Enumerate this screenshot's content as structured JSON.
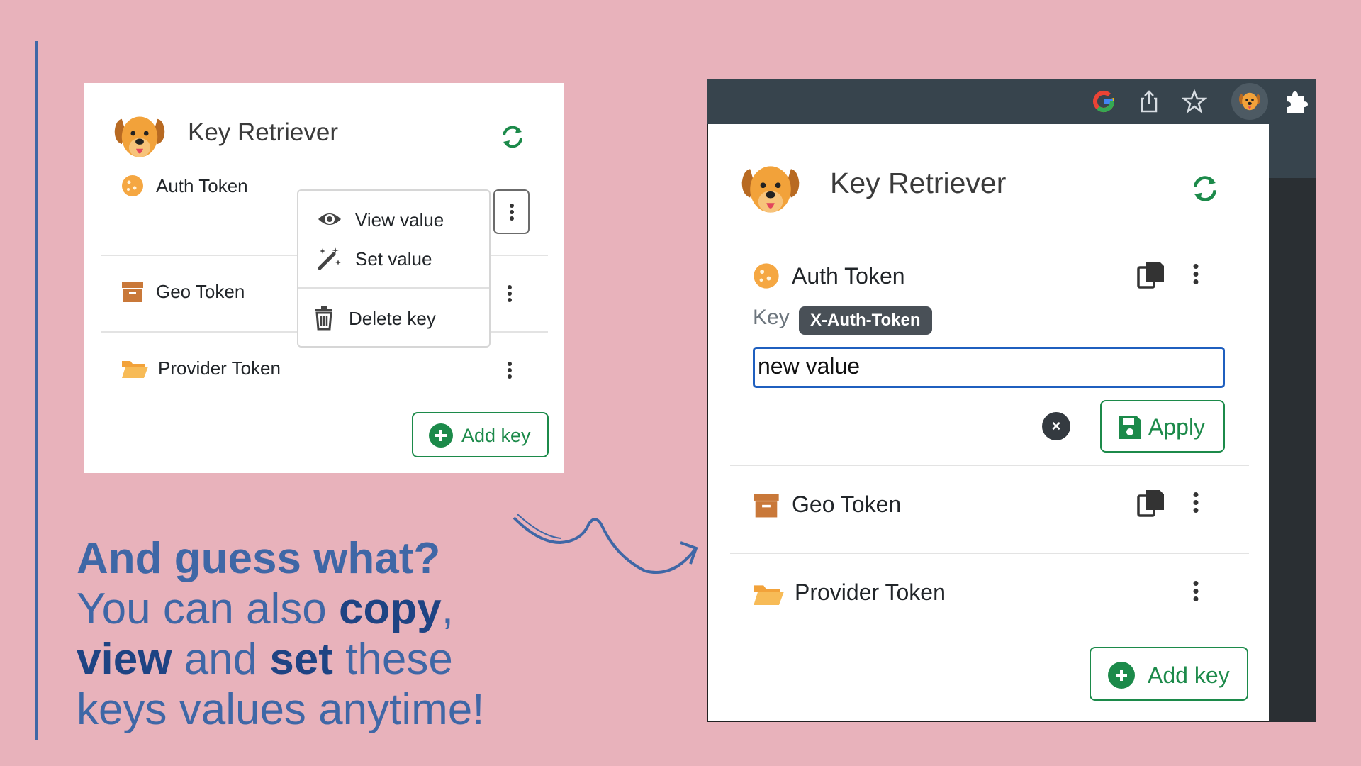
{
  "left_panel": {
    "title": "Key Retriever",
    "rows": [
      {
        "label": "Auth Token",
        "icon": "cookie-icon"
      },
      {
        "label": "Geo Token",
        "icon": "archive-box-icon"
      },
      {
        "label": "Provider Token",
        "icon": "folder-open-icon"
      }
    ],
    "dropdown": {
      "items": [
        {
          "label": "View value",
          "icon": "eye-icon"
        },
        {
          "label": "Set value",
          "icon": "magic-wand-icon"
        },
        {
          "label": "Delete key",
          "icon": "trash-icon"
        }
      ]
    },
    "add_key_label": "Add key"
  },
  "caption": {
    "line1": "And guess what?",
    "line2_prefix": "You can also ",
    "line2_bold": "copy",
    "line2_suffix": ",",
    "line3_bold1": "view",
    "line3_mid": " and ",
    "line3_bold2": "set",
    "line3_suffix": " these",
    "line4": "keys values anytime!"
  },
  "popup": {
    "title": "Key Retriever",
    "rows": [
      {
        "label": "Auth Token",
        "icon": "cookie-icon"
      },
      {
        "label": "Geo Token",
        "icon": "archive-box-icon"
      },
      {
        "label": "Provider Token",
        "icon": "folder-open-icon"
      }
    ],
    "key_label": "Key",
    "key_name": "X-Auth-Token",
    "value_input": "new value",
    "cancel_symbol": "×",
    "apply_label": "Apply",
    "add_key_label": "Add key"
  },
  "toolbar": {
    "icons": [
      "google-icon",
      "share-icon",
      "star-icon",
      "dog-extension-icon",
      "puzzle-extensions-icon"
    ]
  },
  "colors": {
    "background": "#e8b2bb",
    "accent_blue": "#3f67a6",
    "success_green": "#1c8a4a",
    "cookie_orange": "#f5a742",
    "archive_brown": "#c97839"
  }
}
